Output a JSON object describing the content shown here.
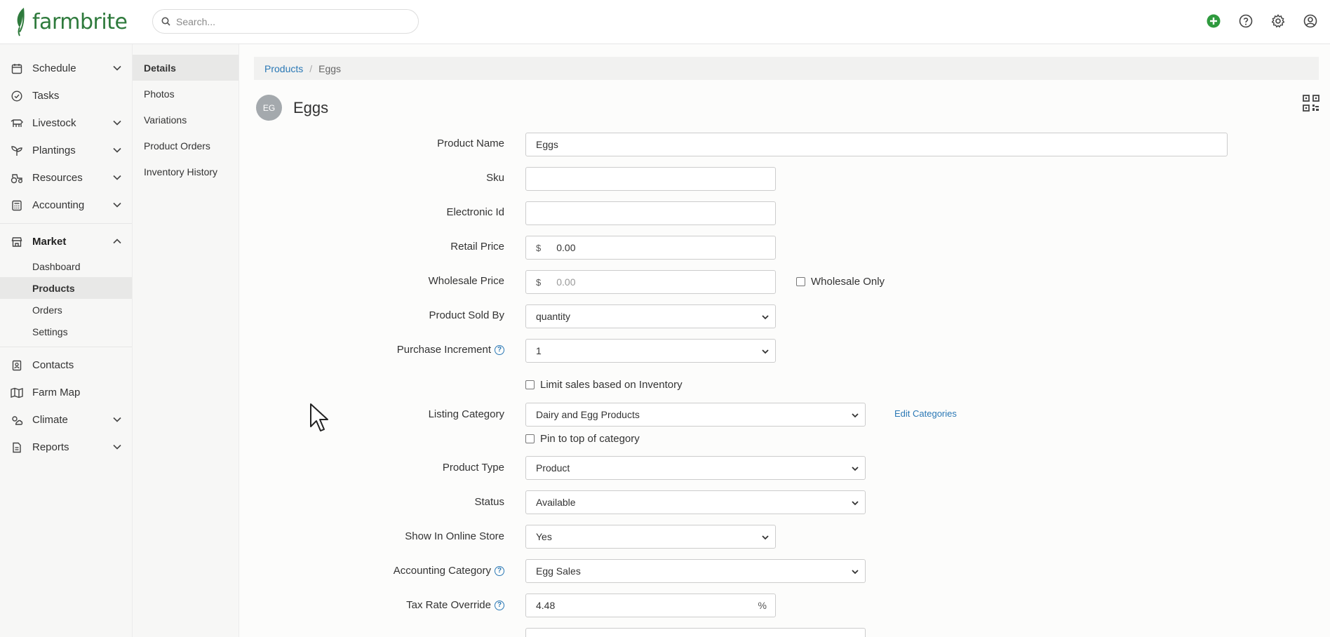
{
  "brand": {
    "name": "farmbrite",
    "color": "#2e7a3c"
  },
  "search": {
    "placeholder": "Search..."
  },
  "top_icons": [
    "add-icon",
    "help-icon",
    "settings-icon",
    "account-icon"
  ],
  "nav": {
    "items": [
      {
        "label": "Schedule",
        "icon": "calendar-icon",
        "expandable": true
      },
      {
        "label": "Tasks",
        "icon": "check-circle-icon",
        "expandable": false
      },
      {
        "label": "Livestock",
        "icon": "cow-icon",
        "expandable": true
      },
      {
        "label": "Plantings",
        "icon": "sprout-icon",
        "expandable": true
      },
      {
        "label": "Resources",
        "icon": "tractor-icon",
        "expandable": true
      },
      {
        "label": "Accounting",
        "icon": "calculator-icon",
        "expandable": true
      },
      {
        "label": "Market",
        "icon": "store-icon",
        "expandable": true,
        "expanded": true
      },
      {
        "label": "Contacts",
        "icon": "contacts-icon",
        "expandable": false
      },
      {
        "label": "Farm Map",
        "icon": "map-icon",
        "expandable": false
      },
      {
        "label": "Climate",
        "icon": "weather-icon",
        "expandable": true
      },
      {
        "label": "Reports",
        "icon": "report-icon",
        "expandable": true
      }
    ],
    "market_sub": [
      "Dashboard",
      "Products",
      "Orders",
      "Settings"
    ],
    "market_selected": "Products"
  },
  "secondary_nav": {
    "items": [
      "Details",
      "Photos",
      "Variations",
      "Product Orders",
      "Inventory History"
    ],
    "selected": "Details"
  },
  "breadcrumb": {
    "parent": "Products",
    "current": "Eggs"
  },
  "product": {
    "initials": "EG",
    "title": "Eggs"
  },
  "form": {
    "product_name": {
      "label": "Product Name",
      "value": "Eggs"
    },
    "sku": {
      "label": "Sku",
      "value": ""
    },
    "electronic_id": {
      "label": "Electronic Id",
      "value": ""
    },
    "retail_price": {
      "label": "Retail Price",
      "prefix": "$",
      "value": "0.00"
    },
    "wholesale_price": {
      "label": "Wholesale Price",
      "prefix": "$",
      "placeholder": "0.00"
    },
    "wholesale_only": {
      "label": "Wholesale Only",
      "checked": false
    },
    "product_sold_by": {
      "label": "Product Sold By",
      "value": "quantity"
    },
    "purchase_increment": {
      "label": "Purchase Increment",
      "value": "1"
    },
    "limit_sales": {
      "label": "Limit sales based on Inventory",
      "checked": false
    },
    "listing_category": {
      "label": "Listing Category",
      "value": "Dairy and Egg Products",
      "edit_link": "Edit Categories"
    },
    "pin_to_top": {
      "label": "Pin to top of category",
      "checked": false
    },
    "product_type": {
      "label": "Product Type",
      "value": "Product"
    },
    "status": {
      "label": "Status",
      "value": "Available"
    },
    "show_online": {
      "label": "Show In Online Store",
      "value": "Yes"
    },
    "accounting_category": {
      "label": "Accounting Category",
      "value": "Egg Sales"
    },
    "tax_rate_override": {
      "label": "Tax Rate Override",
      "value": "4.48",
      "suffix": "%"
    }
  }
}
